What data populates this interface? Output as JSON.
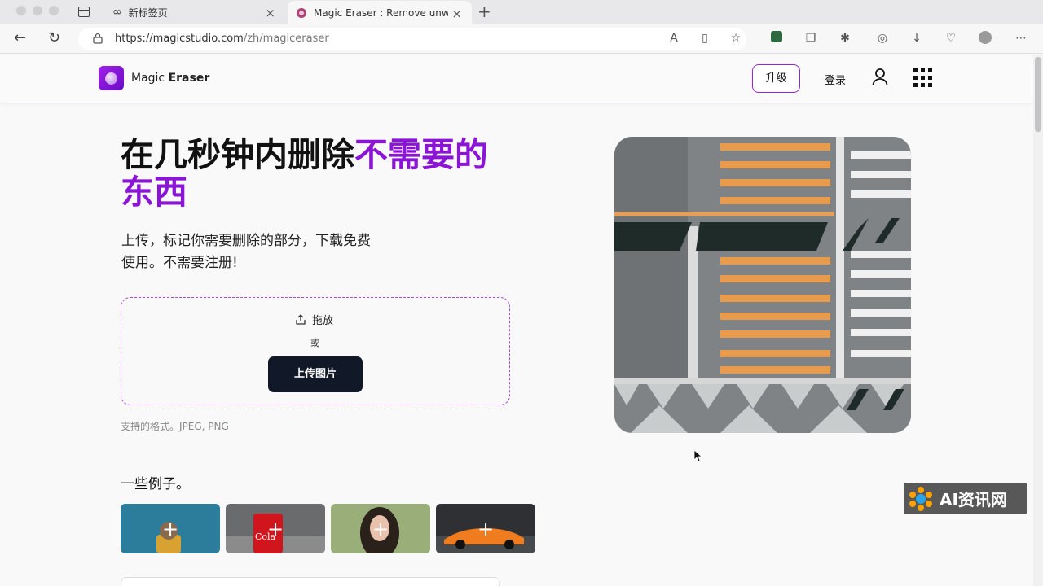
{
  "browser": {
    "tabs": [
      {
        "title": "新标签页"
      },
      {
        "title": "Magic Eraser : Remove unwant"
      }
    ],
    "url_main": "https://magicstudio.com",
    "url_path": "/zh/magiceraser"
  },
  "site": {
    "brand_light": "Magic ",
    "brand_bold": "Eraser",
    "upgrade_label": "升级",
    "login_label": "登录"
  },
  "hero": {
    "headline_part1": "在几秒钟内删除",
    "headline_accent": "不需要的东西",
    "subtitle": "上传，标记你需要删除的部分，下载免费使用。不需要注册!",
    "drag_label": "拖放",
    "or_label": "或",
    "upload_label": "上传图片",
    "formats": "支持的格式。JPEG, PNG"
  },
  "examples": {
    "title": "一些例子。",
    "items": [
      {
        "plus": "+",
        "icon": "dog-photo"
      },
      {
        "plus": "+",
        "icon": "cola-can-photo"
      },
      {
        "plus": "+",
        "icon": "woman-portrait-photo"
      },
      {
        "plus": "+",
        "icon": "sports-car-photo"
      }
    ]
  },
  "watermark": {
    "text": "AI资讯网"
  },
  "colors": {
    "accent": "#8c14d6",
    "button_dark": "#111827"
  }
}
